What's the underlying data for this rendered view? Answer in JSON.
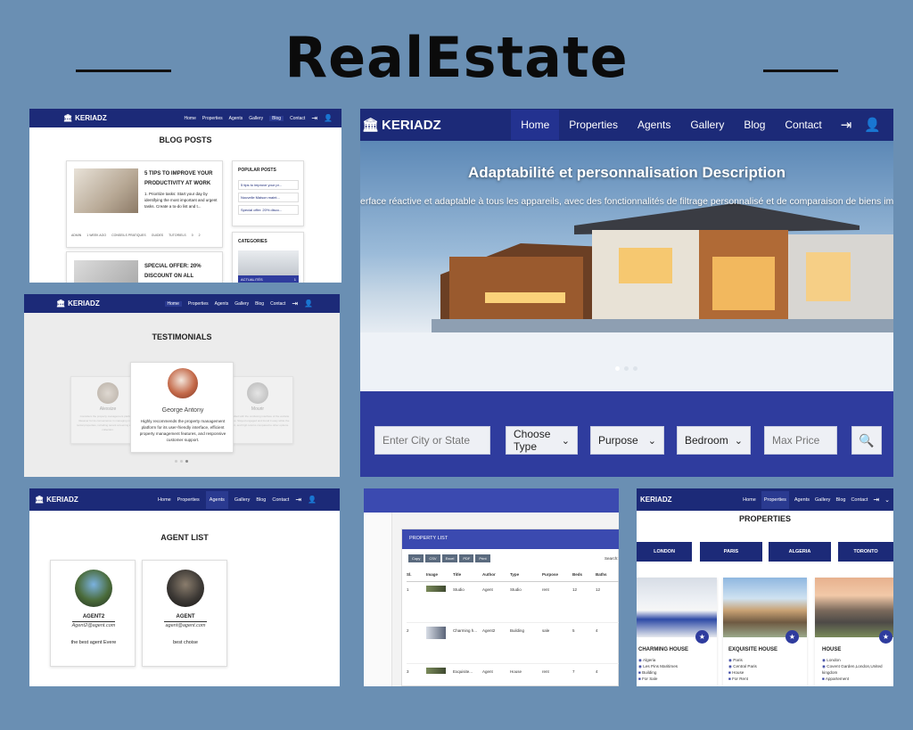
{
  "page": {
    "title": "RealEstate"
  },
  "nav": {
    "logo": "KERIADZ",
    "logo_icon": "bank-icon",
    "items": [
      "Home",
      "Properties",
      "Agents",
      "Gallery",
      "Blog",
      "Contact"
    ],
    "login_icon": "login-icon",
    "add_user_icon": "add-user-icon"
  },
  "blog": {
    "heading": "BLOG POSTS",
    "post1": {
      "title": "5 TIPS TO IMPROVE YOUR PRODUCTIVITY AT WORK",
      "excerpt": "1. Prioritize tasks: Start your day by identifying the most important and urgent tasks. Create a to-do list and t...",
      "meta": [
        "ADMIN",
        "1 WEEK AGO",
        "CONSEILS PRATIQUES",
        "GUIDES",
        "TUTORIELS",
        "0",
        "2"
      ]
    },
    "post2": {
      "title": "SPECIAL OFFER: 20% DISCOUNT ON ALL"
    },
    "popular": {
      "heading": "POPULAR POSTS",
      "items": [
        "5 tips to improve your pr...",
        "Nouvelle Maison maint...",
        "Special offer: 20% disco..."
      ]
    },
    "categories": {
      "heading": "CATEGORIES",
      "first": "ACTUALITÉS",
      "count": "1"
    }
  },
  "hero": {
    "title": "Adaptabilité et personnalisation Description",
    "subtitle": "erface réactive et adaptable à tous les appareils, avec des fonctionnalités de filtrage personnalisé et de comparaison de biens imm",
    "search": {
      "city_placeholder": "Enter City or State",
      "type": "Choose Type",
      "purpose": "Purpose",
      "bedroom": "Bedroom",
      "max_price": "Max Price"
    }
  },
  "testimonials": {
    "heading": "TESTIMONIALS",
    "center": {
      "name": "George Antony",
      "text": "Highly recommends the property management platform for its user-friendly interface, efficient property management features, and responsive customer support."
    },
    "left": {
      "name": "Alexsize",
      "text": "Considers the property management platform a lifesaver for its convenience in managing multiple rental properties, including tenant screening and rent collection."
    },
    "right": {
      "name": "Mourir",
      "text": "Is satisfied with the confusing interface of the website features. Stayed engaged and found it easy while the support, and high returns compared to other options."
    }
  },
  "agents": {
    "heading": "AGENT LIST",
    "list": [
      {
        "name": "AGENT2",
        "email": "Agent2@agent.com",
        "bio": "the best agent Evere"
      },
      {
        "name": "AGENT",
        "email": "agent@agent.com",
        "bio": "best choise"
      }
    ]
  },
  "property_list": {
    "heading": "PROPERTY LIST",
    "buttons": [
      "Copy",
      "CSV",
      "Excel",
      "PDF",
      "Print"
    ],
    "search_label": "Search:",
    "columns": [
      "Sl.",
      "Image",
      "Title",
      "Author",
      "Type",
      "Purpose",
      "Beds",
      "Baths"
    ],
    "rows": [
      [
        "1",
        "",
        "Studio",
        "Agent",
        "Studio",
        "rent",
        "12",
        "12"
      ],
      [
        "2",
        "",
        "Charming h...",
        "Agent2",
        "Building",
        "sale",
        "5",
        "4"
      ],
      [
        "3",
        "",
        "Exquisite...",
        "Agent",
        "House",
        "rent",
        "7",
        "4"
      ]
    ]
  },
  "properties": {
    "heading": "PROPERTIES",
    "cities": [
      "LONDON",
      "PARIS",
      "ALGERIA",
      "TORONTO"
    ],
    "cards": [
      {
        "title": "CHARMING HOUSE",
        "details": [
          "Algeria",
          "Les Pins Maritimes",
          "Building",
          "For Sale"
        ]
      },
      {
        "title": "EXQUISITE HOUSE",
        "details": [
          "Paris",
          "Central Paris",
          "House",
          "For Rent"
        ]
      },
      {
        "title": "HOUSE",
        "details": [
          "London",
          "Covent Garden,London,United kingdom",
          "Appartement"
        ]
      }
    ]
  },
  "colors": {
    "nav": "#1c2a78",
    "accent": "#2f3c9e",
    "background": "#6a8fb3"
  }
}
